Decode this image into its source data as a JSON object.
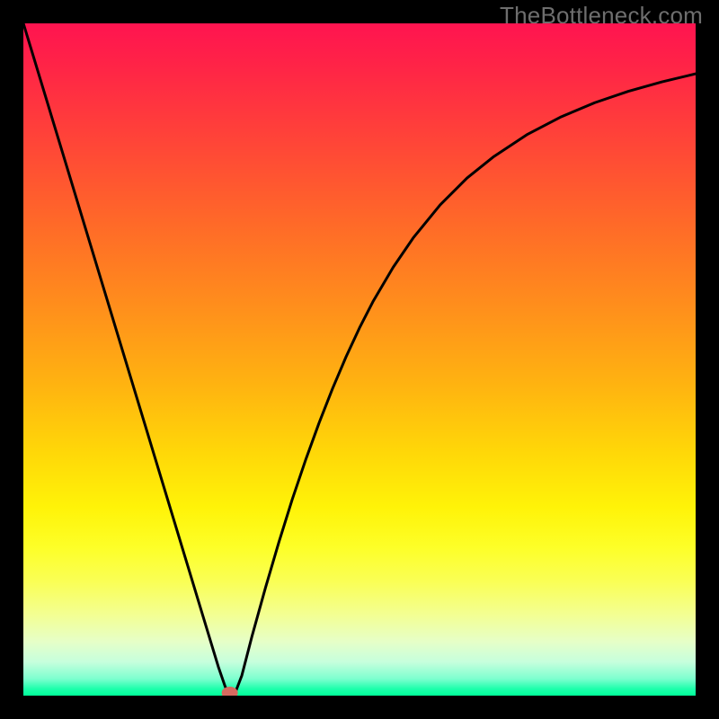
{
  "watermark": "TheBottleneck.com",
  "colors": {
    "curve": "#000000",
    "marker": "#d66a60",
    "frame": "#000000"
  },
  "chart_data": {
    "type": "line",
    "title": "",
    "xlabel": "",
    "ylabel": "",
    "xlim": [
      0,
      100
    ],
    "ylim": [
      0,
      100
    ],
    "grid": false,
    "legend": false,
    "x": [
      0,
      2,
      4,
      6,
      8,
      10,
      12,
      14,
      16,
      18,
      20,
      22,
      24,
      26,
      28,
      29,
      30,
      30.7,
      31.5,
      32.5,
      34,
      36,
      38,
      40,
      42,
      44,
      46,
      48,
      50,
      52,
      55,
      58,
      62,
      66,
      70,
      75,
      80,
      85,
      90,
      95,
      100
    ],
    "values": [
      100,
      93.4,
      86.8,
      80.2,
      73.6,
      67,
      60.4,
      53.8,
      47.2,
      40.6,
      34,
      27.4,
      20.8,
      14.2,
      7.6,
      4.3,
      1.4,
      0,
      0.4,
      3,
      8.8,
      16,
      22.8,
      29.2,
      35.1,
      40.6,
      45.7,
      50.4,
      54.7,
      58.6,
      63.7,
      68.1,
      73,
      77,
      80.2,
      83.5,
      86.1,
      88.2,
      89.9,
      91.3,
      92.5
    ],
    "marker": {
      "x": 30.7,
      "y": 0
    },
    "notes": "V-shaped bottleneck curve on a red→green vertical gradient. Values are percentages estimated from pixel positions; y=0 is at the bottom (green), y=100 at the top (red)."
  }
}
